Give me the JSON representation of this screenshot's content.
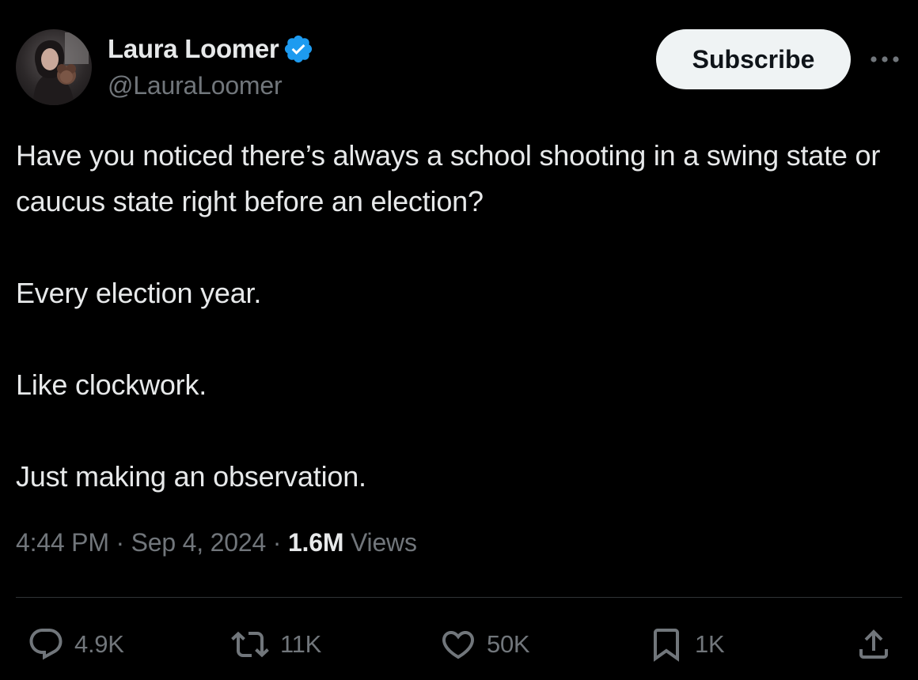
{
  "author": {
    "display_name": "Laura Loomer",
    "handle": "@LauraLoomer",
    "verified_icon": "verified-badge-icon",
    "verified_color": "#1d9bf0"
  },
  "header": {
    "subscribe_label": "Subscribe",
    "more_icon": "more-horizontal-icon"
  },
  "tweet": {
    "paragraphs": [
      "Have you noticed there’s always a school shooting in a swing state or caucus state right before an election?",
      "Every election year.",
      "Like clockwork.",
      "Just making an observation."
    ]
  },
  "meta": {
    "time": "4:44 PM",
    "separator": "·",
    "date": "Sep 4, 2024",
    "views_count": "1.6M",
    "views_label": "Views"
  },
  "actions": {
    "reply": {
      "icon": "reply-icon",
      "count": "4.9K"
    },
    "repost": {
      "icon": "repost-icon",
      "count": "11K"
    },
    "like": {
      "icon": "heart-icon",
      "count": "50K"
    },
    "bookmark": {
      "icon": "bookmark-icon",
      "count": "1K"
    },
    "share": {
      "icon": "share-icon"
    }
  },
  "colors": {
    "background": "#000000",
    "text_primary": "#e7e9ea",
    "text_secondary": "#71767b",
    "divider": "#2f3336",
    "button_bg": "#eff3f4"
  }
}
